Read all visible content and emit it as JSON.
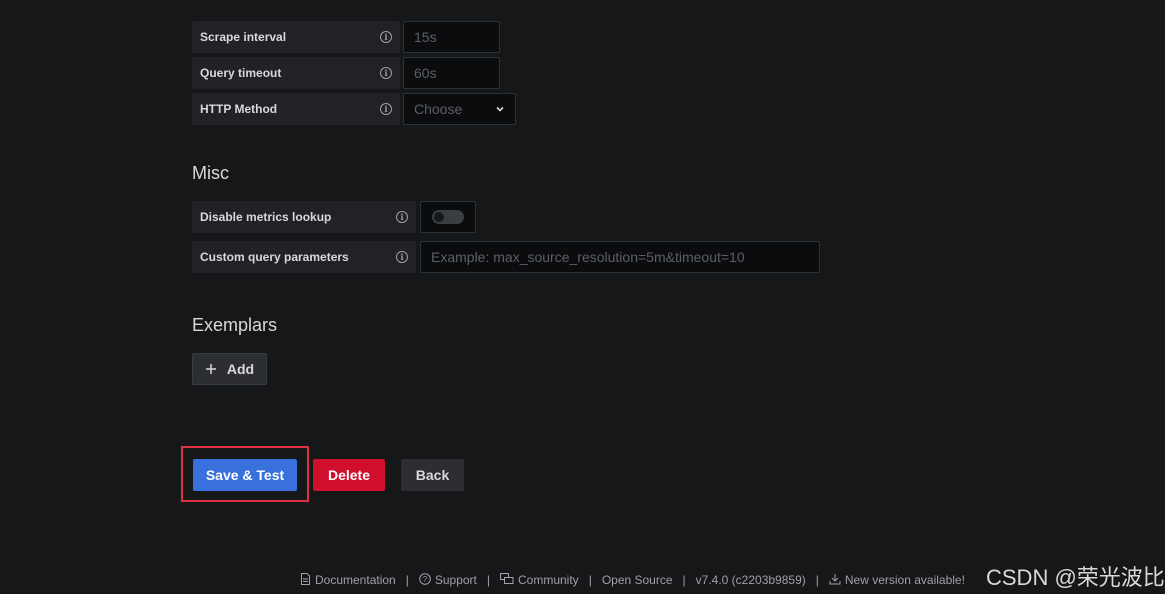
{
  "http_settings": {
    "scrape_interval": {
      "label": "Scrape interval",
      "placeholder": "15s"
    },
    "query_timeout": {
      "label": "Query timeout",
      "placeholder": "60s"
    },
    "http_method": {
      "label": "HTTP Method",
      "value": "Choose"
    }
  },
  "misc": {
    "title": "Misc",
    "disable_metrics_lookup": {
      "label": "Disable metrics lookup",
      "enabled": false
    },
    "custom_query_parameters": {
      "label": "Custom query parameters",
      "placeholder": "Example: max_source_resolution=5m&timeout=10"
    }
  },
  "exemplars": {
    "title": "Exemplars",
    "add_label": "Add"
  },
  "actions": {
    "save_test_label": "Save & Test",
    "delete_label": "Delete",
    "back_label": "Back"
  },
  "footer": {
    "documentation": "Documentation",
    "support": "Support",
    "community": "Community",
    "open_source": "Open Source",
    "version": "v7.4.0 (c2203b9859)",
    "new_version": "New version available!"
  },
  "watermark": "CSDN @荣光波比",
  "colors": {
    "background": "#161719",
    "primary": "#3871dc",
    "danger": "#d10e2b",
    "highlight_border": "#e02f44"
  }
}
